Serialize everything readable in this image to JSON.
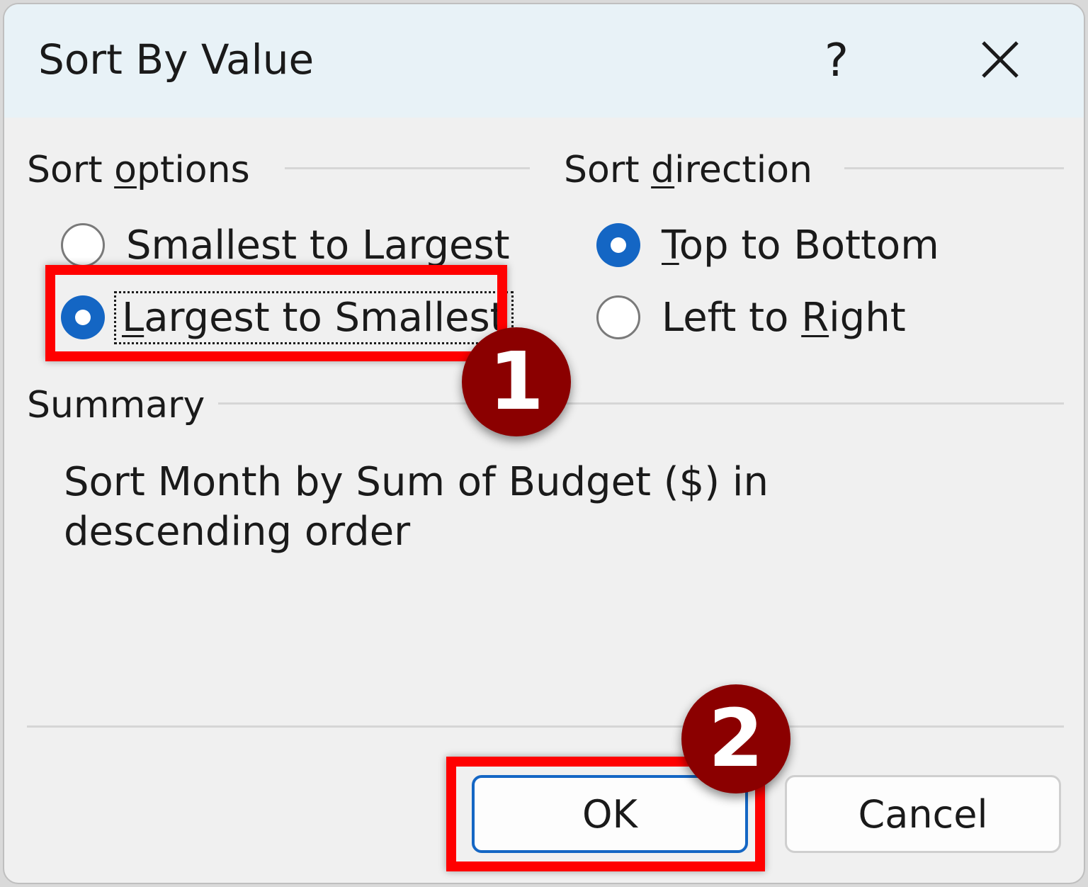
{
  "dialog": {
    "title": "Sort By Value",
    "help_label": "?",
    "close_icon": "close-icon"
  },
  "sort_options": {
    "heading_pre": "Sort ",
    "heading_accel": "o",
    "heading_post": "ptions",
    "options": [
      {
        "label": "Smallest to Largest",
        "checked": false
      },
      {
        "label_accel": "L",
        "label_rest": "argest to Smallest",
        "checked": true
      }
    ]
  },
  "sort_direction": {
    "heading_pre": "Sort ",
    "heading_accel": "d",
    "heading_post": "irection",
    "options": [
      {
        "label_accel": "T",
        "label_rest": "op to Bottom",
        "checked": true
      },
      {
        "label_pre": "Left to ",
        "label_accel": "R",
        "label_rest": "ight",
        "checked": false
      }
    ]
  },
  "summary": {
    "heading": "Summary",
    "text": "Sort Month by Sum of Budget ($) in descending order"
  },
  "buttons": {
    "ok": "OK",
    "cancel": "Cancel"
  },
  "annotations": {
    "badge_1": "1",
    "badge_2": "2",
    "highlight_color": "#ff0000",
    "badge_color": "#8b0000"
  }
}
